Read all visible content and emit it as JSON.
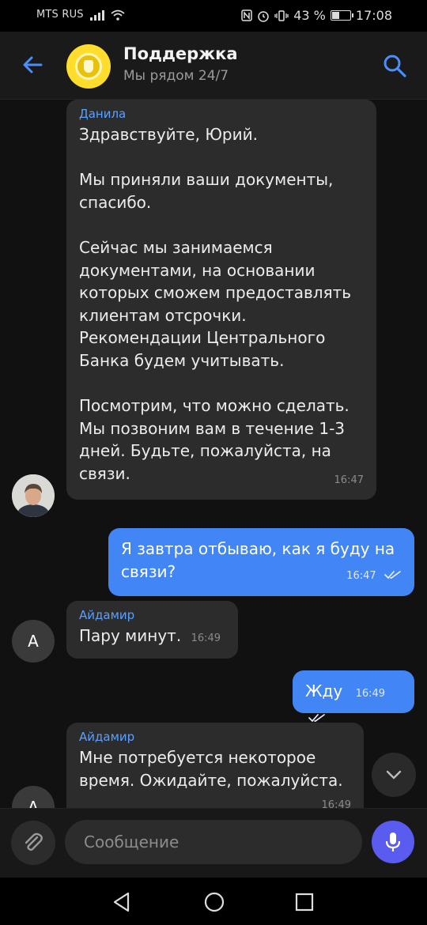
{
  "status": {
    "carrier": "MTS RUS",
    "battery": "43 %",
    "battery_level": 0.43,
    "time": "17:08"
  },
  "header": {
    "title": "Поддержка",
    "subtitle": "Мы рядом 24/7"
  },
  "messages": [
    {
      "direction": "in",
      "sender": "Данила",
      "text": "Здравствуйте, Юрий.\n\nМы приняли ваши документы, спасибо.\n\nСейчас мы занимаемся документами, на основании которых сможем предоставлять клиентам отсрочки. Рекомендации Центрального Банка будем учитывать.\n\nПосмотрим, что можно сделать. Мы позвоним вам в течение 1-3 дней. Будьте, пожалуйста, на связи.",
      "time": "16:47",
      "avatar": "photo"
    },
    {
      "direction": "out",
      "text": "Я завтра отбываю, как я буду на связи?",
      "time": "16:47",
      "read": true
    },
    {
      "direction": "in",
      "sender": "Айдамир",
      "text": "Пару минут.",
      "time": "16:49",
      "avatar_letter": "А"
    },
    {
      "direction": "out",
      "text": "Жду",
      "time": "16:49",
      "read": true
    },
    {
      "direction": "in",
      "sender": "Айдамир",
      "text": "Мне потребуется некоторое время. Ожидайте, пожалуйста.",
      "time": "16:49",
      "avatar_letter": "А"
    }
  ],
  "composer": {
    "placeholder": "Сообщение"
  },
  "colors": {
    "accent": "#4c8ef7",
    "outgoing_bubble": "#4285f4",
    "incoming_bubble": "#2c2c2c",
    "mic_button": "#5a5cf0",
    "logo": "#ffdd2d"
  },
  "icons": [
    "back-arrow-icon",
    "search-icon",
    "paperclip-icon",
    "microphone-icon",
    "chevron-down-icon",
    "double-check-icon",
    "nav-back-icon",
    "nav-home-icon",
    "nav-recents-icon"
  ]
}
